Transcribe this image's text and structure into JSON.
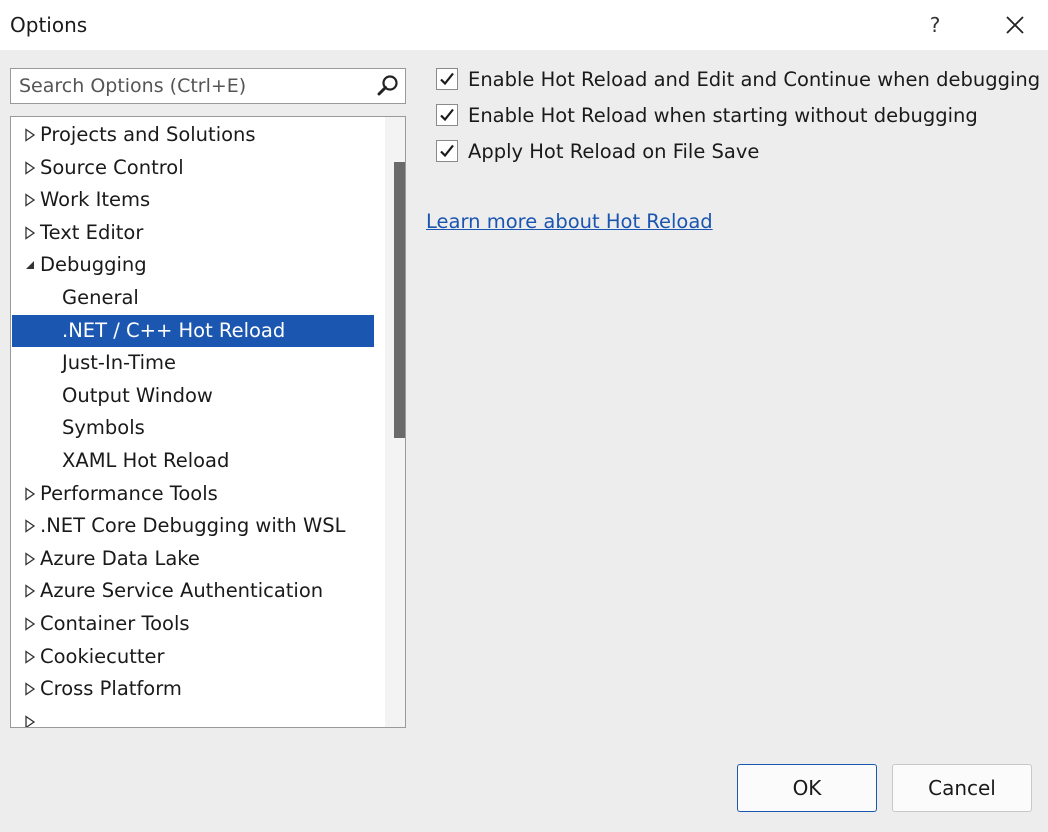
{
  "window": {
    "title": "Options",
    "help_label": "?",
    "close_icon": "close-icon"
  },
  "search": {
    "placeholder": "Search Options (Ctrl+E)",
    "value": "",
    "icon": "search-icon"
  },
  "tree": {
    "items": [
      {
        "label": "Projects and Solutions",
        "level": 0,
        "state": "collapsed"
      },
      {
        "label": "Source Control",
        "level": 0,
        "state": "collapsed"
      },
      {
        "label": "Work Items",
        "level": 0,
        "state": "collapsed"
      },
      {
        "label": "Text Editor",
        "level": 0,
        "state": "collapsed"
      },
      {
        "label": "Debugging",
        "level": 0,
        "state": "expanded"
      },
      {
        "label": "General",
        "level": 1,
        "state": "leaf"
      },
      {
        "label": ".NET / C++ Hot Reload",
        "level": 1,
        "state": "leaf",
        "selected": true
      },
      {
        "label": "Just-In-Time",
        "level": 1,
        "state": "leaf"
      },
      {
        "label": "Output Window",
        "level": 1,
        "state": "leaf"
      },
      {
        "label": "Symbols",
        "level": 1,
        "state": "leaf"
      },
      {
        "label": "XAML Hot Reload",
        "level": 1,
        "state": "leaf"
      },
      {
        "label": "Performance Tools",
        "level": 0,
        "state": "collapsed"
      },
      {
        "label": ".NET Core Debugging with WSL",
        "level": 0,
        "state": "collapsed"
      },
      {
        "label": "Azure Data Lake",
        "level": 0,
        "state": "collapsed"
      },
      {
        "label": "Azure Service Authentication",
        "level": 0,
        "state": "collapsed"
      },
      {
        "label": "Container Tools",
        "level": 0,
        "state": "collapsed"
      },
      {
        "label": "Cookiecutter",
        "level": 0,
        "state": "collapsed"
      },
      {
        "label": "Cross Platform",
        "level": 0,
        "state": "collapsed"
      },
      {
        "label": "",
        "level": 0,
        "state": "collapsed"
      }
    ]
  },
  "options": [
    {
      "label": "Enable Hot Reload and Edit and Continue when debugging",
      "checked": true
    },
    {
      "label": "Enable Hot Reload when starting without debugging",
      "checked": true
    },
    {
      "label": "Apply Hot Reload on File Save",
      "checked": true
    }
  ],
  "link": {
    "label": "Learn more about Hot Reload"
  },
  "buttons": {
    "ok": "OK",
    "cancel": "Cancel"
  },
  "colors": {
    "selection": "#1b57b1",
    "link": "#1a55b0"
  }
}
